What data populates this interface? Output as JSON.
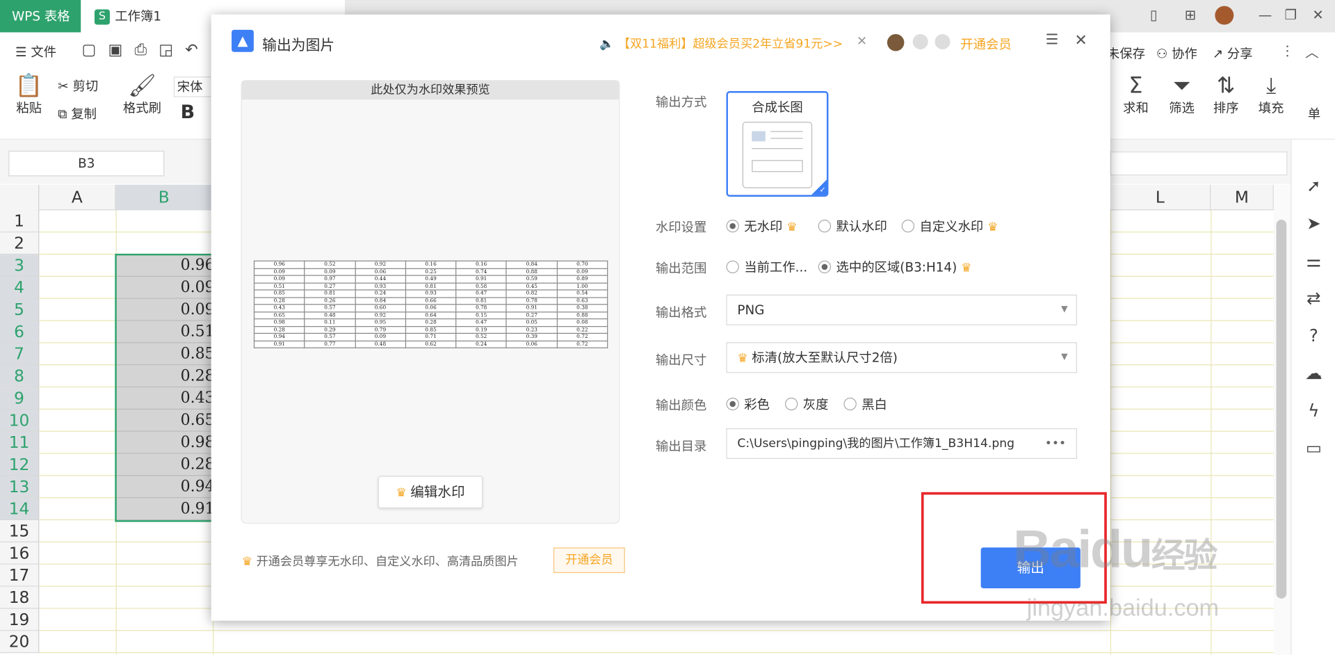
{
  "app": {
    "name": "WPS 表格",
    "doc_tab": "工作簿1",
    "doc_icon": "S"
  },
  "menu": {
    "file": "文件",
    "save_label": "未保存",
    "collab": "协作",
    "share": "分享"
  },
  "ribbon": {
    "paste": "粘贴",
    "cut": "剪切",
    "copy": "复制",
    "format_painter": "格式刷",
    "font": "宋体",
    "bold": "B",
    "sum": "求和",
    "filter": "筛选",
    "sort": "排序",
    "fill": "填充",
    "more": "单"
  },
  "namebox": "B3",
  "columns": [
    "A",
    "B",
    "L",
    "M"
  ],
  "rows": [
    "1",
    "2",
    "3",
    "4",
    "5",
    "6",
    "7",
    "8",
    "9",
    "10",
    "11",
    "12",
    "13",
    "14",
    "15",
    "16",
    "17",
    "18",
    "19",
    "20"
  ],
  "b_cells": [
    "0.96",
    "0.09",
    "0.09",
    "0.51",
    "0.85",
    "0.28",
    "0.43",
    "0.65",
    "0.98",
    "0.28",
    "0.94",
    "0.91"
  ],
  "dialog": {
    "title": "输出为图片",
    "promo": "【双11福利】超级会员买2年立省91元>>",
    "vip_link": "开通会员",
    "preview_title": "此处仅为水印效果预览",
    "edit_watermark": "编辑水印",
    "vip_note": "开通会员尊享无水印、自定义水印、高清品质图片",
    "vip_button": "开通会员",
    "output_mode_label": "输出方式",
    "output_mode": "合成长图",
    "watermark_label": "水印设置",
    "watermark_options": [
      "无水印",
      "默认水印",
      "自定义水印"
    ],
    "range_label": "输出范围",
    "range_options": [
      "当前工作...",
      "选中的区域(B3:H14)"
    ],
    "format_label": "输出格式",
    "format_value": "PNG",
    "size_label": "输出尺寸",
    "size_value": "标清(放大至默认尺寸2倍)",
    "color_label": "输出颜色",
    "color_options": [
      "彩色",
      "灰度",
      "黑白"
    ],
    "dir_label": "输出目录",
    "dir_value": "C:\\Users\\pingping\\我的图片\\工作簿1_B3H14.png",
    "dir_more": "•••",
    "export_button": "输出"
  },
  "preview_table": [
    [
      "0.96",
      "0.52",
      "0.92",
      "0.16",
      "0.16",
      "0.84",
      "0.70"
    ],
    [
      "0.09",
      "0.09",
      "0.06",
      "0.25",
      "0.74",
      "0.88",
      "0.09"
    ],
    [
      "0.09",
      "0.97",
      "0.44",
      "0.49",
      "0.91",
      "0.59",
      "0.89"
    ],
    [
      "0.51",
      "0.27",
      "0.93",
      "0.81",
      "0.58",
      "0.45",
      "1.00"
    ],
    [
      "0.85",
      "0.81",
      "0.24",
      "0.93",
      "0.47",
      "0.82",
      "0.54"
    ],
    [
      "0.28",
      "0.26",
      "0.84",
      "0.66",
      "0.81",
      "0.78",
      "0.63"
    ],
    [
      "0.43",
      "0.57",
      "0.60",
      "0.06",
      "0.78",
      "0.91",
      "0.38"
    ],
    [
      "0.65",
      "0.48",
      "0.92",
      "0.64",
      "0.15",
      "0.27",
      "0.88"
    ],
    [
      "0.98",
      "0.11",
      "0.95",
      "0.28",
      "0.47",
      "0.05",
      "0.08"
    ],
    [
      "0.28",
      "0.29",
      "0.79",
      "0.85",
      "0.19",
      "0.23",
      "0.22"
    ],
    [
      "0.94",
      "0.57",
      "0.09",
      "0.71",
      "0.52",
      "0.39",
      "0.72"
    ],
    [
      "0.91",
      "0.77",
      "0.48",
      "0.62",
      "0.24",
      "0.06",
      "0.72"
    ]
  ],
  "watermark": {
    "brand": "Baidu",
    "brand_cn": "经验",
    "url": "jingyan.baidu.com"
  },
  "colors": {
    "accent": "#2ea26d",
    "vip": "#f5a623",
    "primary": "#3d7ff5",
    "highlight": "#e8282b"
  }
}
